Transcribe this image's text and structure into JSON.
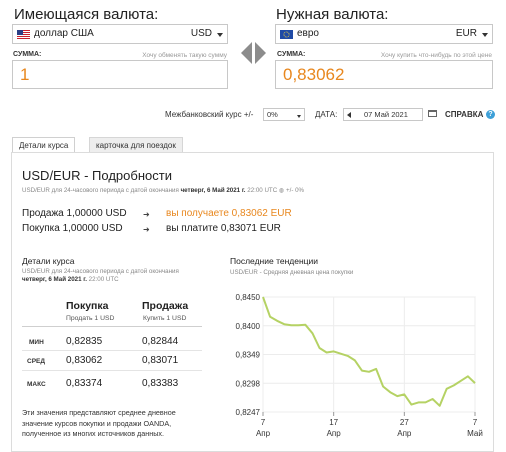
{
  "have": {
    "label": "Имеющаяся валюта:",
    "currency_name": "доллар США",
    "currency_code": "USD",
    "amount_label": "СУММА:",
    "amount_hint": "Хочу обменять такую сумму",
    "amount_value": "1"
  },
  "want": {
    "label": "Нужная валюта:",
    "currency_name": "евро",
    "currency_code": "EUR",
    "amount_label": "СУММА:",
    "amount_hint": "Хочу купить что-нибудь по этой цене",
    "amount_value": "0,83062"
  },
  "controls": {
    "interbank_label": "Межбанковский курс +/-",
    "interbank_value": "0%",
    "date_label": "ДАТА:",
    "date_value": "07 Май 2021",
    "help_label": "СПРАВКА",
    "help_icon": "?"
  },
  "tabs": [
    {
      "label": "Детали курса",
      "active": true
    },
    {
      "label": "карточка для поездок",
      "active": false
    }
  ],
  "details": {
    "title": "USD/EUR - Подробности",
    "meta_prefix": "USD/EUR для 24-часового периода с датой окончания",
    "meta_date": "четверг, 6 Май 2021 г.",
    "meta_suffix": "22:00 UTC ◍ +/- 0%",
    "sell_left": "Продажа 1,00000 USD",
    "sell_arrow": "➜",
    "sell_right": "вы получаете 0,83062 EUR",
    "buy_left": "Покупка 1,00000 USD",
    "buy_arrow": "➜",
    "buy_right": "вы платите 0,83071 EUR"
  },
  "rate_details": {
    "heading": "Детали курса",
    "meta_prefix": "USD/EUR для 24-часового периода с датой окончания",
    "meta_date": "четверг, 6 Май 2021 г.",
    "meta_suffix": "22:00 UTC",
    "col_buy": "Покупка",
    "col_buy_sub": "Продать 1 USD",
    "col_sell": "Продажа",
    "col_sell_sub": "Купить 1 USD",
    "rows": [
      {
        "label": "МИН",
        "buy": "0,82835",
        "sell": "0,82844"
      },
      {
        "label": "СРЕД",
        "buy": "0,83062",
        "sell": "0,83071"
      },
      {
        "label": "МАКС",
        "buy": "0,83374",
        "sell": "0,83383"
      }
    ],
    "note": "Эти значения представляют среднее дневное значение курсов покупки и продажи OANDA, полученное из многих источников данных."
  },
  "trend": {
    "heading": "Последние тенденции",
    "subtitle": "USD/EUR - Средняя дневная цена покупки"
  },
  "chart_data": {
    "type": "area",
    "y_ticks": [
      "0,8450",
      "0,8400",
      "0,8349",
      "0,8298",
      "0,8247"
    ],
    "ylim": [
      0.8247,
      0.845
    ],
    "x_ticks": [
      {
        "day": "7",
        "month": "Апр"
      },
      {
        "day": "17",
        "month": "Апр"
      },
      {
        "day": "27",
        "month": "Апр"
      },
      {
        "day": "7",
        "month": "Май"
      }
    ],
    "x_range_days": [
      0,
      30
    ],
    "series": [
      {
        "x": [
          0,
          1,
          2,
          3,
          4,
          5,
          6,
          7,
          8,
          9,
          10,
          11,
          12,
          13,
          14,
          15,
          16,
          17,
          18,
          19,
          20,
          21,
          22,
          23,
          24,
          25,
          26,
          27,
          28,
          29,
          30
        ],
        "y": [
          0.845,
          0.8415,
          0.8408,
          0.8402,
          0.84,
          0.84,
          0.8401,
          0.8386,
          0.836,
          0.8352,
          0.8354,
          0.835,
          0.8346,
          0.8338,
          0.832,
          0.8318,
          0.8323,
          0.8292,
          0.8282,
          0.8275,
          0.8278,
          0.826,
          0.8264,
          0.8264,
          0.827,
          0.8258,
          0.8288,
          0.8294,
          0.8302,
          0.831,
          0.8298
        ],
        "color": "#b5d264"
      }
    ]
  }
}
